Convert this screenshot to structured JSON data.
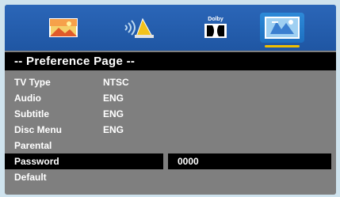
{
  "tabs": [
    {
      "name": "general-setup",
      "icon": "picture-icon"
    },
    {
      "name": "audio-setup",
      "icon": "speaker-icon"
    },
    {
      "name": "dolby-setup",
      "icon": "dolby-icon",
      "label": "Dolby"
    },
    {
      "name": "preference-setup",
      "icon": "preference-icon",
      "selected": true
    }
  ],
  "header": {
    "title": "-- Preference  Page --"
  },
  "rows": [
    {
      "label": "TV  Type",
      "value": "NTSC"
    },
    {
      "label": "Audio",
      "value": "ENG"
    },
    {
      "label": "Subtitle",
      "value": "ENG"
    },
    {
      "label": "Disc Menu",
      "value": "ENG"
    },
    {
      "label": "Parental",
      "value": ""
    },
    {
      "label": "Password",
      "value": "",
      "selected": true
    },
    {
      "label": "Default",
      "value": ""
    }
  ],
  "password_field": {
    "value": "0000"
  },
  "colors": {
    "tabbar": "#2b66b8",
    "panel": "#7f7f7f",
    "highlight_bar": "#000000",
    "tab_underline": "#f0c000"
  }
}
